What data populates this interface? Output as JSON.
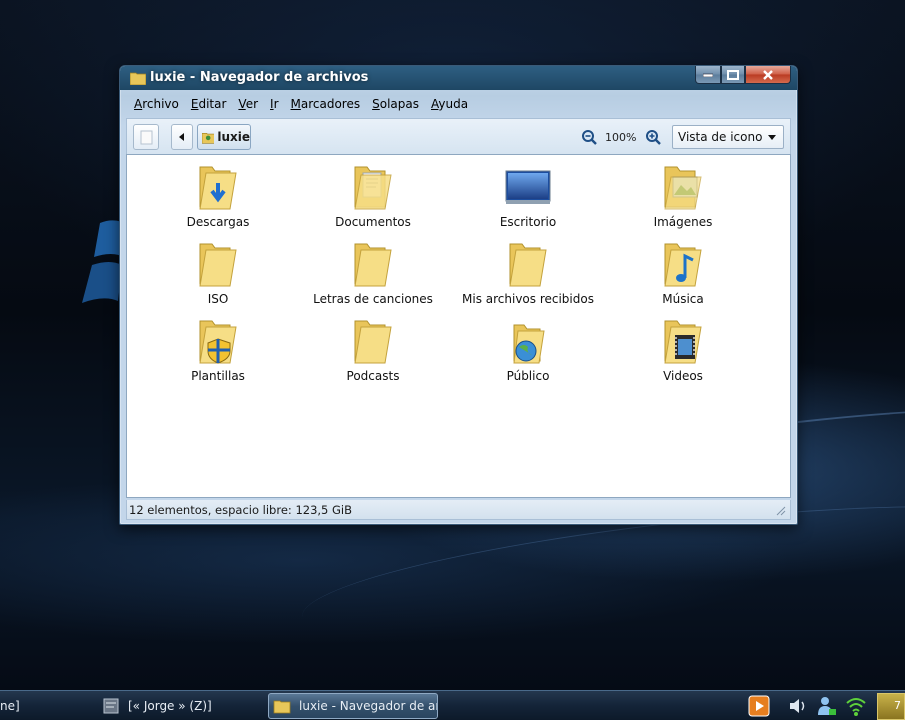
{
  "window": {
    "title": "luxie - Navegador de archivos"
  },
  "menu": [
    "Archivo",
    "Editar",
    "Ver",
    "Ir",
    "Marcadores",
    "Solapas",
    "Ayuda"
  ],
  "toolbar": {
    "breadcrumb": "luxie",
    "zoom": "100%",
    "view_mode": "Vista de icono"
  },
  "files": [
    {
      "name": "Descargas",
      "icon": "downloads-folder-icon"
    },
    {
      "name": "Documentos",
      "icon": "documents-folder-icon"
    },
    {
      "name": "Escritorio",
      "icon": "desktop-icon"
    },
    {
      "name": "Imágenes",
      "icon": "pictures-folder-icon"
    },
    {
      "name": "ISO",
      "icon": "folder-icon"
    },
    {
      "name": "Letras de canciones",
      "icon": "folder-icon"
    },
    {
      "name": "Mis archivos recibidos",
      "icon": "folder-icon"
    },
    {
      "name": "Música",
      "icon": "music-folder-icon"
    },
    {
      "name": "Plantillas",
      "icon": "templates-folder-icon"
    },
    {
      "name": "Podcasts",
      "icon": "folder-icon"
    },
    {
      "name": "Público",
      "icon": "public-folder-icon"
    },
    {
      "name": "Videos",
      "icon": "videos-folder-icon"
    }
  ],
  "status": "12 elementos, espacio libre: 123,5 GiB",
  "taskbar": {
    "tasks": [
      {
        "label": "ne]"
      },
      {
        "label": "[« Jorge » (Z)]"
      },
      {
        "label": "luxie - Navegador de ar..."
      }
    ],
    "tray_badge": "7"
  },
  "colors": {
    "titlebar": "#1e4764",
    "folder": "#f2d56b",
    "accent": "#2e6ca4"
  }
}
